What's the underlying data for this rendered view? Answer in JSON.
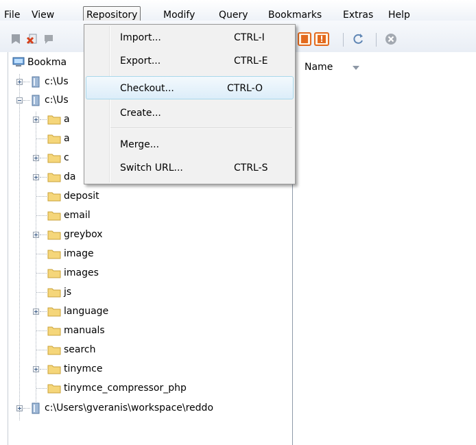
{
  "menubar": {
    "items": [
      {
        "id": "file",
        "label": "File"
      },
      {
        "id": "view",
        "label": "View"
      },
      {
        "id": "repository",
        "label": "Repository"
      },
      {
        "id": "modify",
        "label": "Modify"
      },
      {
        "id": "query",
        "label": "Query"
      },
      {
        "id": "bookmarks",
        "label": "Bookmarks"
      },
      {
        "id": "extras",
        "label": "Extras"
      },
      {
        "id": "help",
        "label": "Help"
      }
    ],
    "open_menu": "Repository"
  },
  "repository_menu": {
    "items": [
      {
        "label": "Import...",
        "shortcut": "CTRL-I"
      },
      {
        "label": "Export...",
        "shortcut": "CTRL-E"
      },
      {
        "label": "Checkout...",
        "shortcut": "CTRL-O",
        "highlighted": true
      },
      {
        "label": "Create...",
        "shortcut": ""
      },
      {
        "label": "Merge...",
        "shortcut": ""
      },
      {
        "label": "Switch URL...",
        "shortcut": "CTRL-S"
      }
    ]
  },
  "tree": {
    "root_label": "Bookma",
    "nodes": [
      {
        "label": "c:\\Us",
        "type": "repo"
      },
      {
        "label": "c:\\Us",
        "type": "repo"
      },
      {
        "label": "a",
        "type": "folder"
      },
      {
        "label": "a",
        "type": "folder"
      },
      {
        "label": "c",
        "type": "folder"
      },
      {
        "label": "da",
        "type": "folder"
      },
      {
        "label": "deposit",
        "type": "folder"
      },
      {
        "label": "email",
        "type": "folder"
      },
      {
        "label": "greybox",
        "type": "folder"
      },
      {
        "label": "image",
        "type": "folder"
      },
      {
        "label": "images",
        "type": "folder"
      },
      {
        "label": "js",
        "type": "folder"
      },
      {
        "label": "language",
        "type": "folder"
      },
      {
        "label": "manuals",
        "type": "folder"
      },
      {
        "label": "search",
        "type": "folder"
      },
      {
        "label": "tinymce",
        "type": "folder"
      },
      {
        "label": "tinymce_compressor_php",
        "type": "folder"
      },
      {
        "label": "c:\\Users\\gveranis\\workspace\\reddo",
        "type": "repo"
      }
    ]
  },
  "right_panel": {
    "column_header": "Name"
  },
  "colors": {
    "menu_highlight": "#dcedf9",
    "folder": "#f5d67a",
    "accent_orange": "#e36a1e"
  }
}
